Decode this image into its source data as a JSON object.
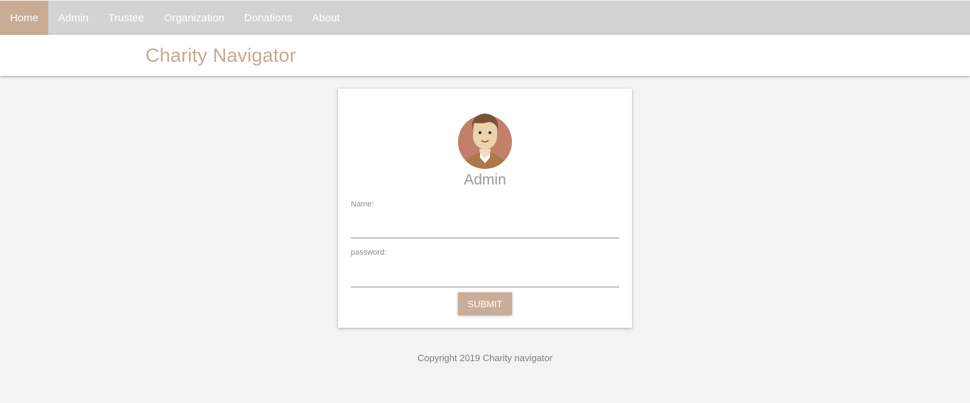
{
  "nav": {
    "items": [
      {
        "label": "Home",
        "active": true
      },
      {
        "label": "Admin",
        "active": false
      },
      {
        "label": "Trustee",
        "active": false
      },
      {
        "label": "Organization",
        "active": false
      },
      {
        "label": "Donations",
        "active": false
      },
      {
        "label": "About",
        "active": false
      }
    ]
  },
  "header": {
    "title": "Charity Navigator"
  },
  "login": {
    "avatar_icon": "user-avatar-icon",
    "title": "Admin",
    "name_label": "Name:",
    "name_value": "",
    "password_label": "password:",
    "password_value": "",
    "submit_label": "SUBMIT"
  },
  "footer": {
    "text": "Copyright 2019 Charity navigator"
  },
  "colors": {
    "accent": "#c8ab95",
    "nav_bg": "#d3d3d3",
    "page_bg": "#f3f3f3"
  }
}
